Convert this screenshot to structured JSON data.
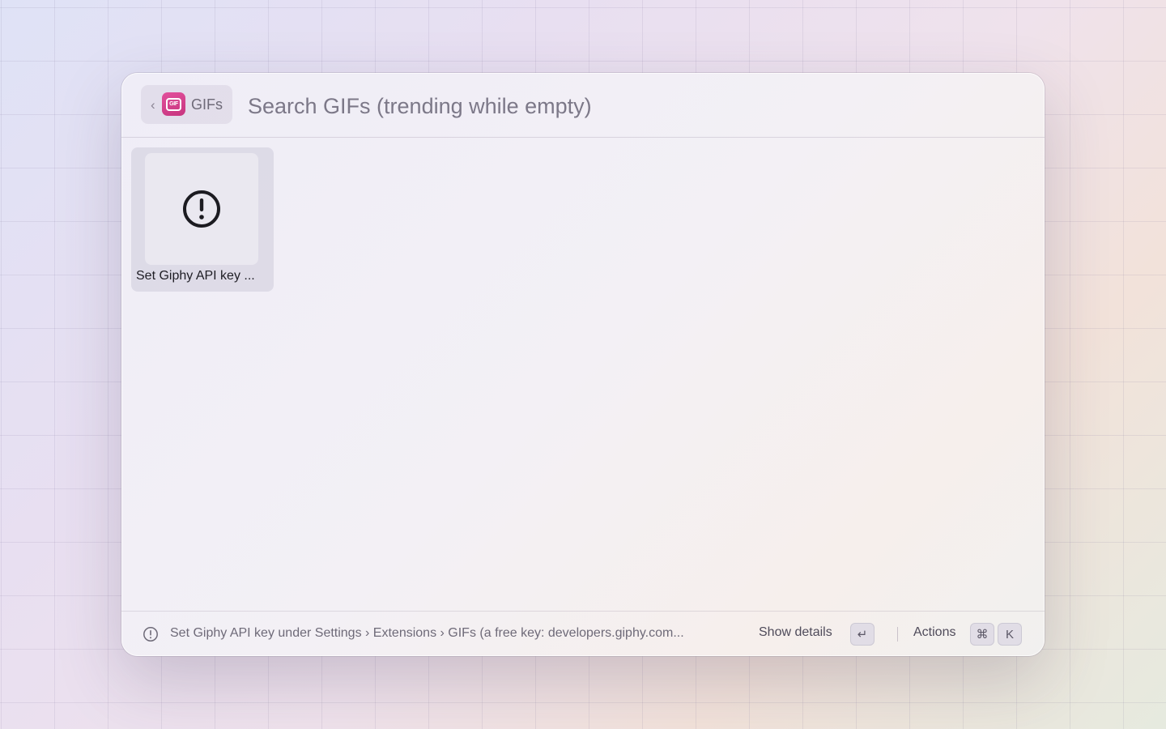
{
  "header": {
    "back_chevron": "‹",
    "extension_icon": "gif-icon",
    "extension_icon_text": "GIF",
    "extension_name": "GIFs",
    "search_placeholder": "Search GIFs (trending while empty)",
    "search_value": ""
  },
  "grid": {
    "items": [
      {
        "icon": "exclamation-circle-icon",
        "title": "Set Giphy API key ..."
      }
    ]
  },
  "footer": {
    "status_icon": "exclamation-circle-icon",
    "message": "Set Giphy API key under Settings › Extensions › GIFs (a free key: developers.giphy.com...",
    "primary_action_label": "Show details",
    "primary_action_key": "↵",
    "actions_label": "Actions",
    "actions_key_modifier": "⌘",
    "actions_key": "K"
  },
  "colors": {
    "accent_pink": "#d8448e",
    "text_primary": "#1e1d24",
    "text_secondary": "#6e6a78"
  }
}
